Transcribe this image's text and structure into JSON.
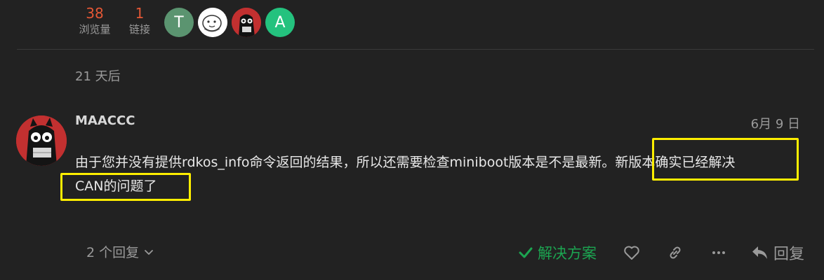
{
  "stats": {
    "views": {
      "count": "38",
      "label": "浏览量"
    },
    "links": {
      "count": "1",
      "label": "链接"
    }
  },
  "participants": [
    {
      "initial": "T",
      "color": "#5b9470"
    },
    {
      "initial": "",
      "color": "#ffffff"
    },
    {
      "initial": "",
      "color": "#c23030"
    },
    {
      "initial": "A",
      "color": "#24c27e"
    }
  ],
  "time_gap": "21 天后",
  "post": {
    "username": "MAACCC",
    "date": "6月 9 日",
    "body_line1": "由于您并没有提供rdkos_info命令返回的结果，所以还需要检查miniboot版本是不是最新。新版本确实已经解决",
    "body_line2": "CAN的问题了"
  },
  "actions": {
    "replies": "2 个回复",
    "solution": "解决方案",
    "reply": "回复"
  },
  "colors": {
    "background": "#222222",
    "accent_orange": "#e45735",
    "solution_green": "#1ca551",
    "highlight_yellow": "#ffee00"
  }
}
